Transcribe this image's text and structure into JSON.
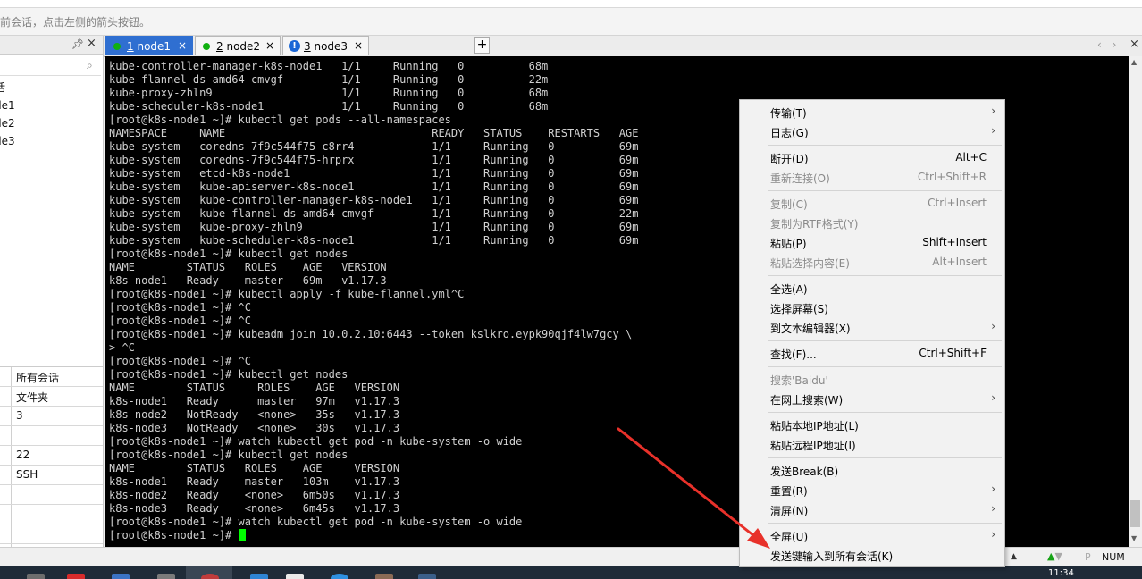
{
  "hint_bar": {
    "text": "前会话，点击左侧的箭头按钮。"
  },
  "left_panel": {
    "tree_items": [
      "话",
      "de1",
      "de2",
      "de3"
    ],
    "props": [
      "所有会话",
      "文件夹",
      "3",
      "",
      "22",
      "SSH",
      "",
      "",
      "",
      ""
    ]
  },
  "tabs": [
    {
      "number": "1",
      "name": "node1",
      "status": "connected",
      "active": true
    },
    {
      "number": "2",
      "name": "node2",
      "status": "connected",
      "active": false
    },
    {
      "number": "3",
      "name": "node3",
      "status": "warning",
      "active": false
    }
  ],
  "tab_close_glyph": "×",
  "add_tab_glyph": "+",
  "terminal": {
    "lines": [
      "kube-controller-manager-k8s-node1   1/1     Running   0          68m",
      "kube-flannel-ds-amd64-cmvgf         1/1     Running   0          22m",
      "kube-proxy-zhln9                    1/1     Running   0          68m",
      "kube-scheduler-k8s-node1            1/1     Running   0          68m",
      "[root@k8s-node1 ~]# kubectl get pods --all-namespaces",
      "NAMESPACE     NAME                                READY   STATUS    RESTARTS   AGE",
      "kube-system   coredns-7f9c544f75-c8rr4            1/1     Running   0          69m",
      "kube-system   coredns-7f9c544f75-hrprx            1/1     Running   0          69m",
      "kube-system   etcd-k8s-node1                      1/1     Running   0          69m",
      "kube-system   kube-apiserver-k8s-node1            1/1     Running   0          69m",
      "kube-system   kube-controller-manager-k8s-node1   1/1     Running   0          69m",
      "kube-system   kube-flannel-ds-amd64-cmvgf         1/1     Running   0          22m",
      "kube-system   kube-proxy-zhln9                    1/1     Running   0          69m",
      "kube-system   kube-scheduler-k8s-node1            1/1     Running   0          69m",
      "[root@k8s-node1 ~]# kubectl get nodes",
      "NAME        STATUS   ROLES    AGE   VERSION",
      "k8s-node1   Ready    master   69m   v1.17.3",
      "[root@k8s-node1 ~]# kubectl apply -f kube-flannel.yml^C",
      "[root@k8s-node1 ~]# ^C",
      "[root@k8s-node1 ~]# ^C",
      "[root@k8s-node1 ~]# kubeadm join 10.0.2.10:6443 --token kslkro.eypk90qjf4lw7gcy \\",
      "> ^C",
      "[root@k8s-node1 ~]# ^C",
      "[root@k8s-node1 ~]# kubectl get nodes",
      "NAME        STATUS     ROLES    AGE   VERSION",
      "k8s-node1   Ready      master   97m   v1.17.3",
      "k8s-node2   NotReady   <none>   35s   v1.17.3",
      "k8s-node3   NotReady   <none>   30s   v1.17.3",
      "[root@k8s-node1 ~]# watch kubectl get pod -n kube-system -o wide",
      "[root@k8s-node1 ~]# kubectl get nodes",
      "NAME        STATUS   ROLES    AGE     VERSION",
      "k8s-node1   Ready    master   103m    v1.17.3",
      "k8s-node2   Ready    <none>   6m50s   v1.17.3",
      "k8s-node3   Ready    <none>   6m45s   v1.17.3",
      "[root@k8s-node1 ~]# watch kubectl get pod -n kube-system -o wide"
    ],
    "prompt": "[root@k8s-node1 ~]# "
  },
  "context_menu": {
    "items": [
      {
        "label": "传输(T)",
        "shortcut": "",
        "submenu": true,
        "enabled": true
      },
      {
        "label": "日志(G)",
        "shortcut": "",
        "submenu": true,
        "enabled": true
      },
      {
        "sep": true
      },
      {
        "label": "断开(D)",
        "shortcut": "Alt+C",
        "submenu": false,
        "enabled": true
      },
      {
        "label": "重新连接(O)",
        "shortcut": "Ctrl+Shift+R",
        "submenu": false,
        "enabled": false
      },
      {
        "sep": true
      },
      {
        "label": "复制(C)",
        "shortcut": "Ctrl+Insert",
        "submenu": false,
        "enabled": false
      },
      {
        "label": "复制为RTF格式(Y)",
        "shortcut": "",
        "submenu": false,
        "enabled": false
      },
      {
        "label": "粘贴(P)",
        "shortcut": "Shift+Insert",
        "submenu": false,
        "enabled": true
      },
      {
        "label": "粘贴选择内容(E)",
        "shortcut": "Alt+Insert",
        "submenu": false,
        "enabled": false
      },
      {
        "sep": true
      },
      {
        "label": "全选(A)",
        "shortcut": "",
        "submenu": false,
        "enabled": true
      },
      {
        "label": "选择屏幕(S)",
        "shortcut": "",
        "submenu": false,
        "enabled": true
      },
      {
        "label": "到文本编辑器(X)",
        "shortcut": "",
        "submenu": true,
        "enabled": true
      },
      {
        "sep": true
      },
      {
        "label": "查找(F)...",
        "shortcut": "Ctrl+Shift+F",
        "submenu": false,
        "enabled": true
      },
      {
        "sep": true
      },
      {
        "label": "搜索'Baidu'",
        "shortcut": "",
        "submenu": false,
        "enabled": false
      },
      {
        "label": "在网上搜索(W)",
        "shortcut": "",
        "submenu": true,
        "enabled": true
      },
      {
        "sep": true
      },
      {
        "label": "粘贴本地IP地址(L)",
        "shortcut": "",
        "submenu": false,
        "enabled": true
      },
      {
        "label": "粘贴远程IP地址(I)",
        "shortcut": "",
        "submenu": false,
        "enabled": true
      },
      {
        "sep": true
      },
      {
        "label": "发送Break(B)",
        "shortcut": "",
        "submenu": false,
        "enabled": true
      },
      {
        "label": "重置(R)",
        "shortcut": "",
        "submenu": true,
        "enabled": true
      },
      {
        "label": "清屏(N)",
        "shortcut": "",
        "submenu": true,
        "enabled": true
      },
      {
        "sep": true
      },
      {
        "label": "全屏(U)",
        "shortcut": "",
        "submenu": true,
        "enabled": true
      },
      {
        "label": "发送键输入到所有会话(K)",
        "shortcut": "",
        "submenu": false,
        "enabled": true
      }
    ]
  },
  "status_bar": {
    "num_indicator": "NUM",
    "p_indicator": "P"
  },
  "taskbar": {
    "time": "11:34"
  },
  "colors": {
    "terminal_bg": "#000000",
    "terminal_fg": "#d0d0d0",
    "cursor": "#00ff00",
    "active_tab": "#2f6fd1",
    "annotation_arrow": "#e8312a"
  }
}
